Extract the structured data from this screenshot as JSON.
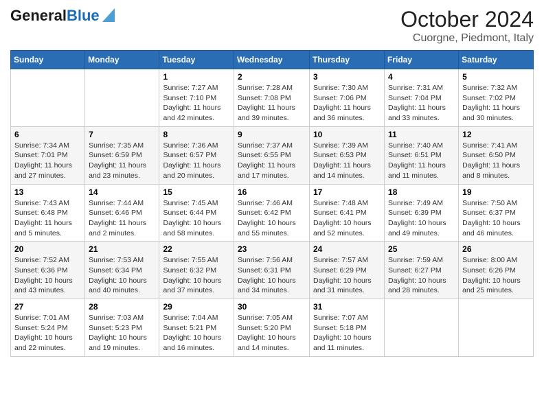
{
  "logo": {
    "general": "General",
    "blue": "Blue"
  },
  "title": "October 2024",
  "subtitle": "Cuorgne, Piedmont, Italy",
  "headers": [
    "Sunday",
    "Monday",
    "Tuesday",
    "Wednesday",
    "Thursday",
    "Friday",
    "Saturday"
  ],
  "weeks": [
    [
      {
        "num": "",
        "sunrise": "",
        "sunset": "",
        "daylight": ""
      },
      {
        "num": "",
        "sunrise": "",
        "sunset": "",
        "daylight": ""
      },
      {
        "num": "1",
        "sunrise": "Sunrise: 7:27 AM",
        "sunset": "Sunset: 7:10 PM",
        "daylight": "Daylight: 11 hours and 42 minutes."
      },
      {
        "num": "2",
        "sunrise": "Sunrise: 7:28 AM",
        "sunset": "Sunset: 7:08 PM",
        "daylight": "Daylight: 11 hours and 39 minutes."
      },
      {
        "num": "3",
        "sunrise": "Sunrise: 7:30 AM",
        "sunset": "Sunset: 7:06 PM",
        "daylight": "Daylight: 11 hours and 36 minutes."
      },
      {
        "num": "4",
        "sunrise": "Sunrise: 7:31 AM",
        "sunset": "Sunset: 7:04 PM",
        "daylight": "Daylight: 11 hours and 33 minutes."
      },
      {
        "num": "5",
        "sunrise": "Sunrise: 7:32 AM",
        "sunset": "Sunset: 7:02 PM",
        "daylight": "Daylight: 11 hours and 30 minutes."
      }
    ],
    [
      {
        "num": "6",
        "sunrise": "Sunrise: 7:34 AM",
        "sunset": "Sunset: 7:01 PM",
        "daylight": "Daylight: 11 hours and 27 minutes."
      },
      {
        "num": "7",
        "sunrise": "Sunrise: 7:35 AM",
        "sunset": "Sunset: 6:59 PM",
        "daylight": "Daylight: 11 hours and 23 minutes."
      },
      {
        "num": "8",
        "sunrise": "Sunrise: 7:36 AM",
        "sunset": "Sunset: 6:57 PM",
        "daylight": "Daylight: 11 hours and 20 minutes."
      },
      {
        "num": "9",
        "sunrise": "Sunrise: 7:37 AM",
        "sunset": "Sunset: 6:55 PM",
        "daylight": "Daylight: 11 hours and 17 minutes."
      },
      {
        "num": "10",
        "sunrise": "Sunrise: 7:39 AM",
        "sunset": "Sunset: 6:53 PM",
        "daylight": "Daylight: 11 hours and 14 minutes."
      },
      {
        "num": "11",
        "sunrise": "Sunrise: 7:40 AM",
        "sunset": "Sunset: 6:51 PM",
        "daylight": "Daylight: 11 hours and 11 minutes."
      },
      {
        "num": "12",
        "sunrise": "Sunrise: 7:41 AM",
        "sunset": "Sunset: 6:50 PM",
        "daylight": "Daylight: 11 hours and 8 minutes."
      }
    ],
    [
      {
        "num": "13",
        "sunrise": "Sunrise: 7:43 AM",
        "sunset": "Sunset: 6:48 PM",
        "daylight": "Daylight: 11 hours and 5 minutes."
      },
      {
        "num": "14",
        "sunrise": "Sunrise: 7:44 AM",
        "sunset": "Sunset: 6:46 PM",
        "daylight": "Daylight: 11 hours and 2 minutes."
      },
      {
        "num": "15",
        "sunrise": "Sunrise: 7:45 AM",
        "sunset": "Sunset: 6:44 PM",
        "daylight": "Daylight: 10 hours and 58 minutes."
      },
      {
        "num": "16",
        "sunrise": "Sunrise: 7:46 AM",
        "sunset": "Sunset: 6:42 PM",
        "daylight": "Daylight: 10 hours and 55 minutes."
      },
      {
        "num": "17",
        "sunrise": "Sunrise: 7:48 AM",
        "sunset": "Sunset: 6:41 PM",
        "daylight": "Daylight: 10 hours and 52 minutes."
      },
      {
        "num": "18",
        "sunrise": "Sunrise: 7:49 AM",
        "sunset": "Sunset: 6:39 PM",
        "daylight": "Daylight: 10 hours and 49 minutes."
      },
      {
        "num": "19",
        "sunrise": "Sunrise: 7:50 AM",
        "sunset": "Sunset: 6:37 PM",
        "daylight": "Daylight: 10 hours and 46 minutes."
      }
    ],
    [
      {
        "num": "20",
        "sunrise": "Sunrise: 7:52 AM",
        "sunset": "Sunset: 6:36 PM",
        "daylight": "Daylight: 10 hours and 43 minutes."
      },
      {
        "num": "21",
        "sunrise": "Sunrise: 7:53 AM",
        "sunset": "Sunset: 6:34 PM",
        "daylight": "Daylight: 10 hours and 40 minutes."
      },
      {
        "num": "22",
        "sunrise": "Sunrise: 7:55 AM",
        "sunset": "Sunset: 6:32 PM",
        "daylight": "Daylight: 10 hours and 37 minutes."
      },
      {
        "num": "23",
        "sunrise": "Sunrise: 7:56 AM",
        "sunset": "Sunset: 6:31 PM",
        "daylight": "Daylight: 10 hours and 34 minutes."
      },
      {
        "num": "24",
        "sunrise": "Sunrise: 7:57 AM",
        "sunset": "Sunset: 6:29 PM",
        "daylight": "Daylight: 10 hours and 31 minutes."
      },
      {
        "num": "25",
        "sunrise": "Sunrise: 7:59 AM",
        "sunset": "Sunset: 6:27 PM",
        "daylight": "Daylight: 10 hours and 28 minutes."
      },
      {
        "num": "26",
        "sunrise": "Sunrise: 8:00 AM",
        "sunset": "Sunset: 6:26 PM",
        "daylight": "Daylight: 10 hours and 25 minutes."
      }
    ],
    [
      {
        "num": "27",
        "sunrise": "Sunrise: 7:01 AM",
        "sunset": "Sunset: 5:24 PM",
        "daylight": "Daylight: 10 hours and 22 minutes."
      },
      {
        "num": "28",
        "sunrise": "Sunrise: 7:03 AM",
        "sunset": "Sunset: 5:23 PM",
        "daylight": "Daylight: 10 hours and 19 minutes."
      },
      {
        "num": "29",
        "sunrise": "Sunrise: 7:04 AM",
        "sunset": "Sunset: 5:21 PM",
        "daylight": "Daylight: 10 hours and 16 minutes."
      },
      {
        "num": "30",
        "sunrise": "Sunrise: 7:05 AM",
        "sunset": "Sunset: 5:20 PM",
        "daylight": "Daylight: 10 hours and 14 minutes."
      },
      {
        "num": "31",
        "sunrise": "Sunrise: 7:07 AM",
        "sunset": "Sunset: 5:18 PM",
        "daylight": "Daylight: 10 hours and 11 minutes."
      },
      {
        "num": "",
        "sunrise": "",
        "sunset": "",
        "daylight": ""
      },
      {
        "num": "",
        "sunrise": "",
        "sunset": "",
        "daylight": ""
      }
    ]
  ]
}
